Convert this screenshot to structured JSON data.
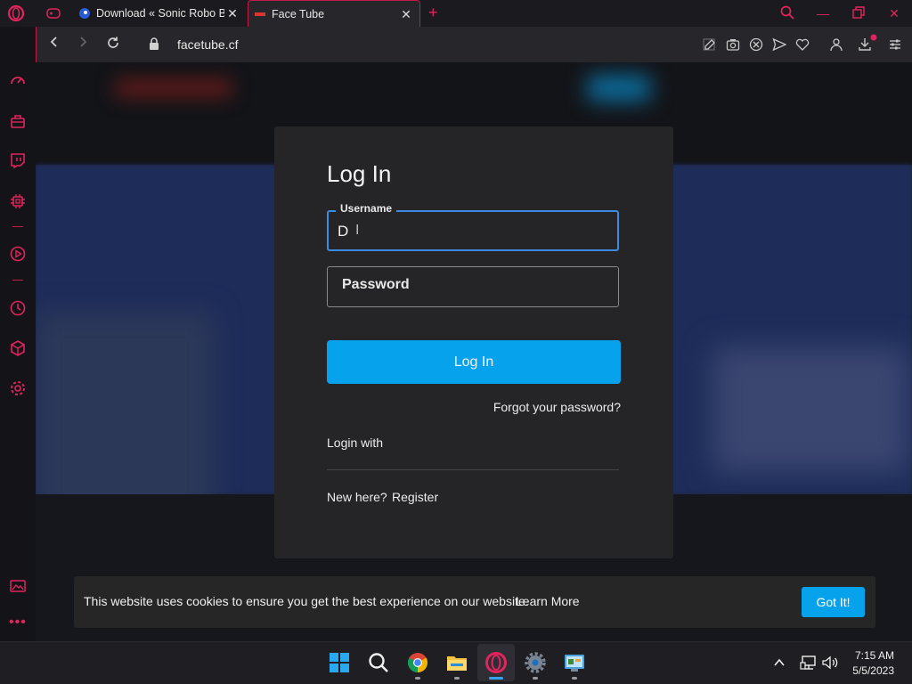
{
  "browser": {
    "tabs": [
      {
        "title": "Download « Sonic Robo Bl",
        "active": false
      },
      {
        "title": "Face Tube",
        "active": true
      }
    ],
    "url": "facetube.cf",
    "accent_color": "#e0245e"
  },
  "login": {
    "title": "Log In",
    "username_label": "Username",
    "username_value": "D",
    "password_placeholder": "Password",
    "login_button": "Log In",
    "forgot_password": "Forgot your password?",
    "login_with": "Login with",
    "new_here": "New here?",
    "register": "Register",
    "button_color": "#06a3ec"
  },
  "cookie": {
    "message": "This website uses cookies to ensure you get the best experience on our website.",
    "learn_more": "Learn More",
    "button": "Got It!"
  },
  "taskbar": {
    "apps": [
      "windows-start",
      "search",
      "chrome",
      "file-explorer",
      "opera",
      "settings",
      "control-panel"
    ],
    "time": "7:15 AM",
    "date": "5/5/2023"
  }
}
